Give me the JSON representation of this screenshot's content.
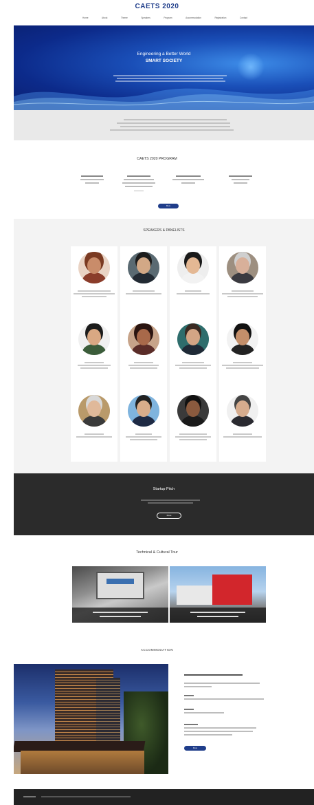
{
  "header": {
    "logo": "CAETS 2020",
    "nav": [
      "Home",
      "About",
      "Theme",
      "Speakers",
      "Program",
      "Accommodation",
      "Registration",
      "Contact"
    ]
  },
  "hero": {
    "title": "Engineering a Better World",
    "subtitle": "SMART SOCIETY"
  },
  "program": {
    "title": "CAETS 2020 PROGRAM",
    "button": "More"
  },
  "speakers": {
    "title": "SPEAKERS & PANELISTS"
  },
  "startup": {
    "title": "Startup Pitch",
    "button": "More"
  },
  "tour": {
    "title": "Technical & Cultural Tour"
  },
  "accommodation": {
    "title": "ACCOMMODATION",
    "button": "More"
  },
  "colors": {
    "brand": "#1f3d8a",
    "dark": "#2b2b2b"
  }
}
